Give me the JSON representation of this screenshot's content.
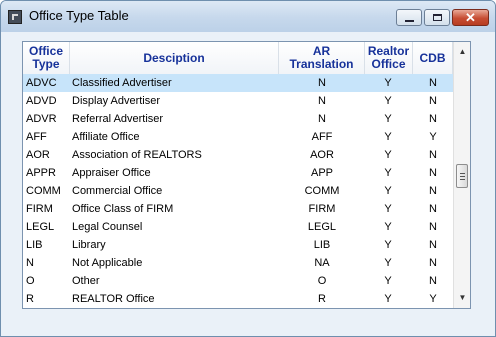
{
  "window": {
    "title": "Office Type Table",
    "close_glyph": "✕"
  },
  "icons": {
    "app": "app-icon",
    "minimize": "minimize-icon",
    "maximize": "maximize-icon",
    "close": "close-icon",
    "scroll_up": "scroll-up-arrow-icon",
    "scroll_down": "scroll-down-arrow-icon"
  },
  "colors": {
    "header_text": "#17329a",
    "selected_row": "#c7e4fa",
    "close_button": "#c74d33"
  },
  "table": {
    "columns": {
      "type_line1": "Office",
      "type_line2": "Type",
      "description": "Desciption",
      "ar_line1": "AR",
      "ar_line2": "Translation",
      "realtor_line1": "Realtor",
      "realtor_line2": "Office",
      "cdb": "CDB"
    },
    "rows": [
      {
        "type": "ADVC",
        "desc": "Classified Advertiser",
        "ar": "N",
        "realtor": "Y",
        "cdb": "N"
      },
      {
        "type": "ADVD",
        "desc": "Display Advertiser",
        "ar": "N",
        "realtor": "Y",
        "cdb": "N"
      },
      {
        "type": "ADVR",
        "desc": "Referral Advertiser",
        "ar": "N",
        "realtor": "Y",
        "cdb": "N"
      },
      {
        "type": "AFF",
        "desc": "Affiliate Office",
        "ar": "AFF",
        "realtor": "Y",
        "cdb": "Y"
      },
      {
        "type": "AOR",
        "desc": "Association of REALTORS",
        "ar": "AOR",
        "realtor": "Y",
        "cdb": "N"
      },
      {
        "type": "APPR",
        "desc": "Appraiser Office",
        "ar": "APP",
        "realtor": "Y",
        "cdb": "N"
      },
      {
        "type": "COMM",
        "desc": "Commercial Office",
        "ar": "COMM",
        "realtor": "Y",
        "cdb": "N"
      },
      {
        "type": "FIRM",
        "desc": "Office Class of FIRM",
        "ar": "FIRM",
        "realtor": "Y",
        "cdb": "N"
      },
      {
        "type": "LEGL",
        "desc": "Legal Counsel",
        "ar": "LEGL",
        "realtor": "Y",
        "cdb": "N"
      },
      {
        "type": "LIB",
        "desc": "Library",
        "ar": "LIB",
        "realtor": "Y",
        "cdb": "N"
      },
      {
        "type": "N",
        "desc": "Not Applicable",
        "ar": "NA",
        "realtor": "Y",
        "cdb": "N"
      },
      {
        "type": "O",
        "desc": "Other",
        "ar": "O",
        "realtor": "Y",
        "cdb": "N"
      },
      {
        "type": "R",
        "desc": "REALTOR Office",
        "ar": "R",
        "realtor": "Y",
        "cdb": "Y"
      }
    ]
  }
}
